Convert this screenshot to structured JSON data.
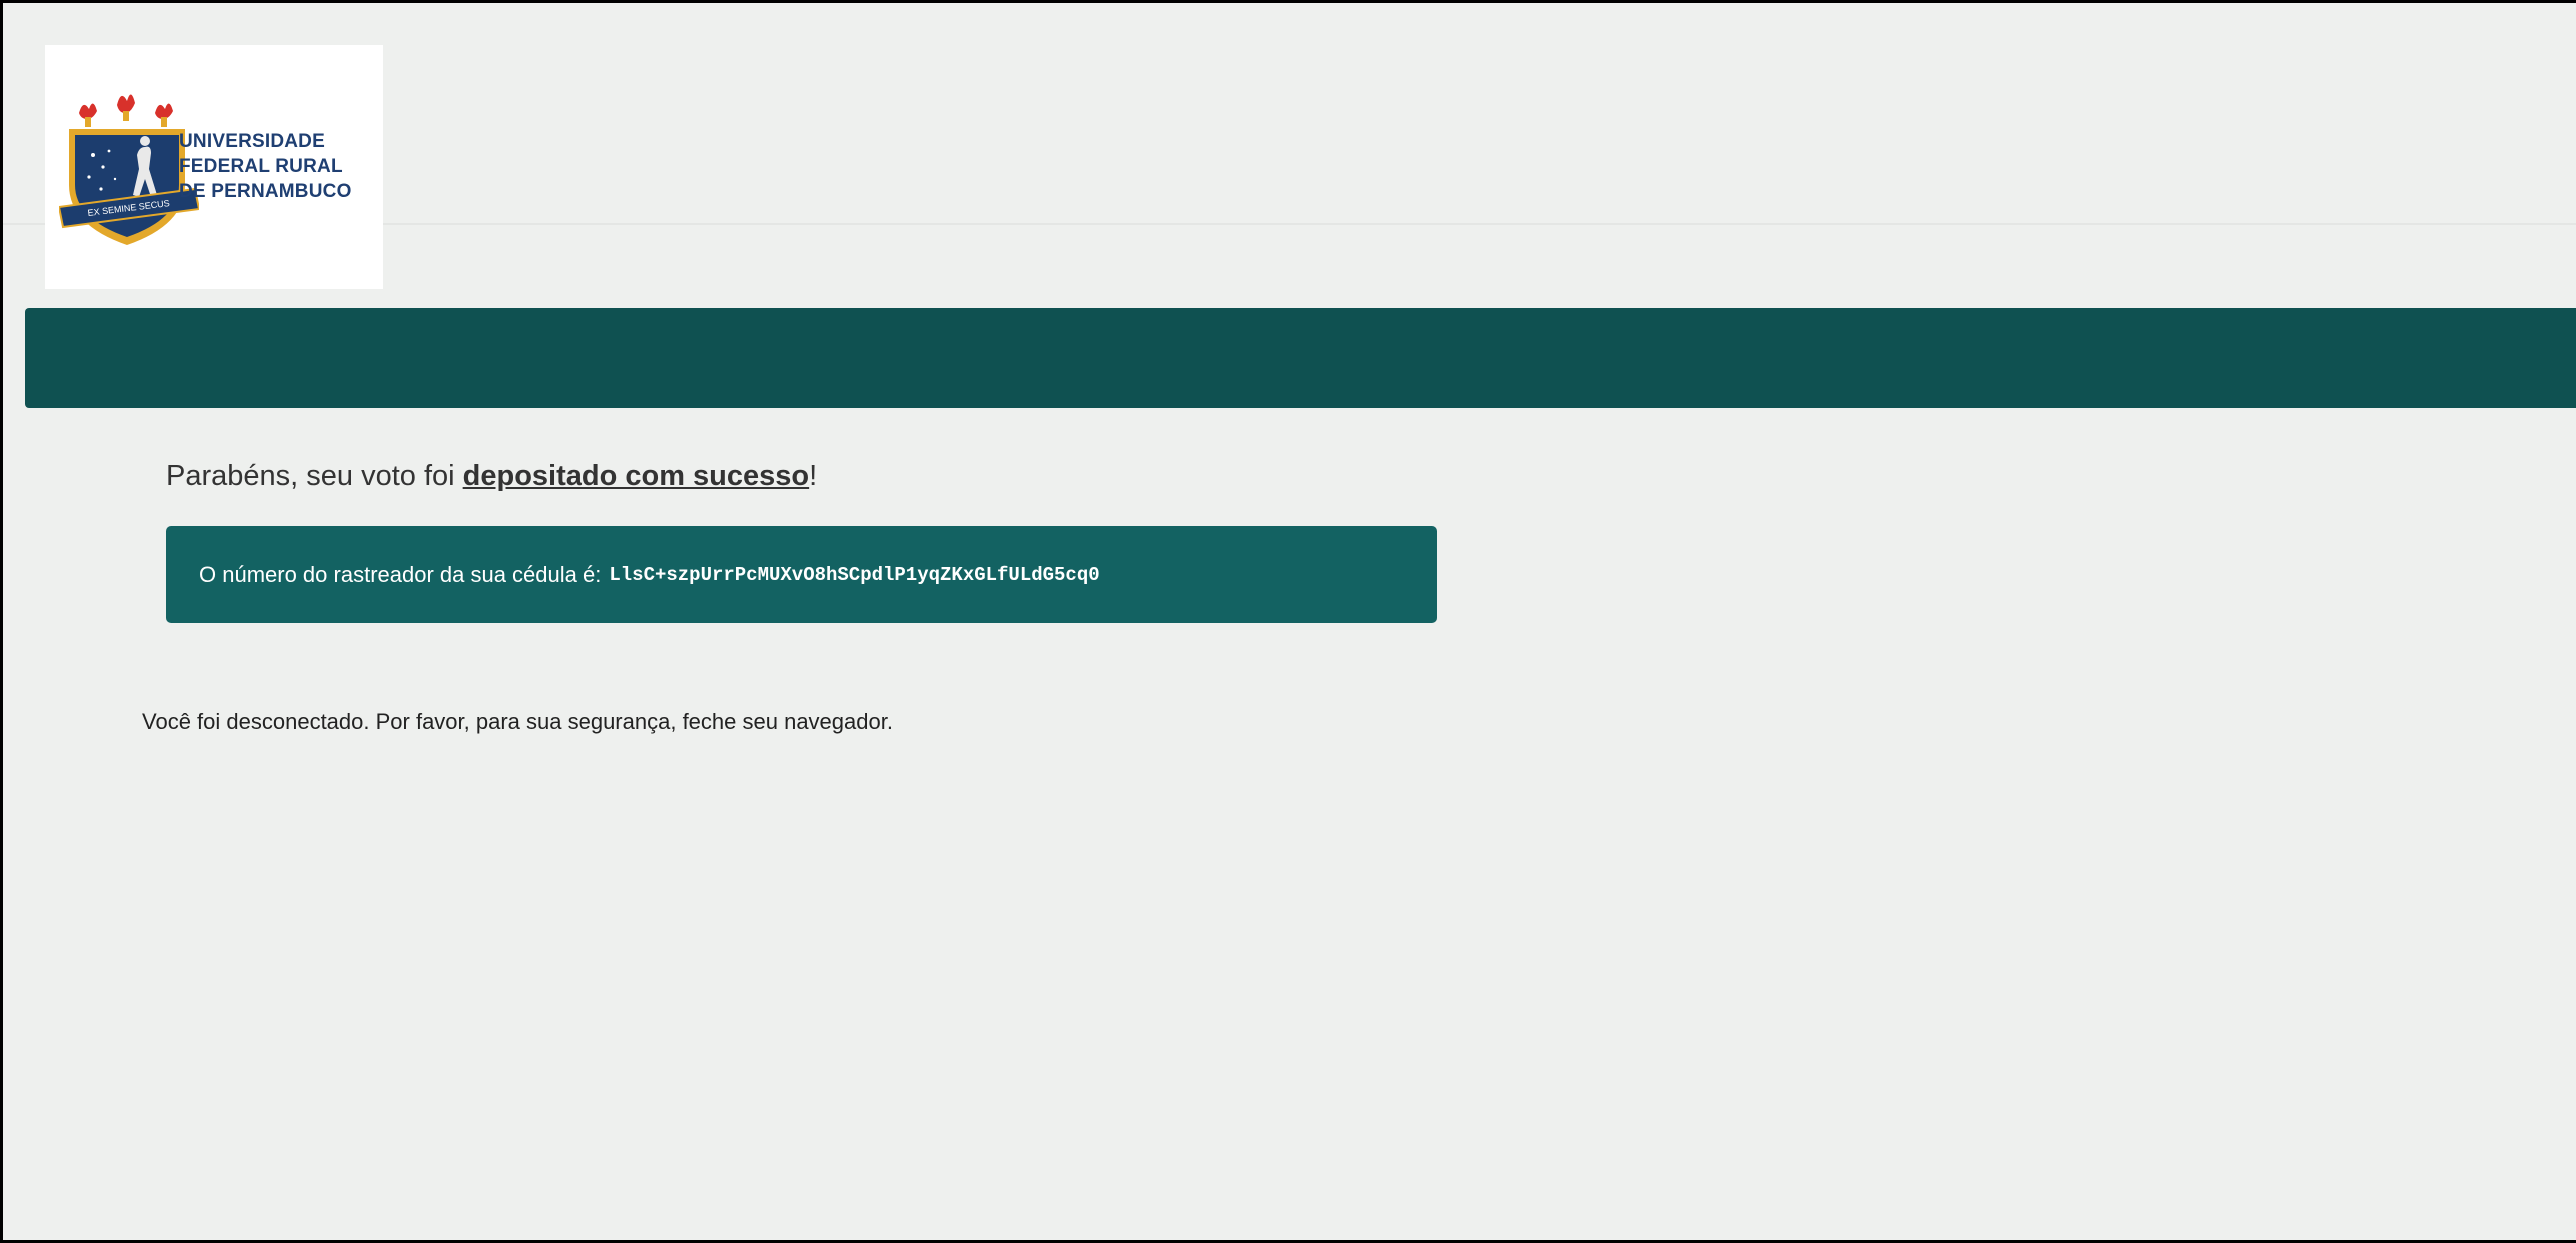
{
  "brand": {
    "logo_lines": [
      "UNIVERSIDADE",
      "FEDERAL RURAL",
      "DE PERNAMBUCO"
    ],
    "crest_motto": "EX SEMINE SECUS"
  },
  "colors": {
    "page_background": "#eef0ee",
    "header_bar": "#0f5151",
    "tracker_box": "#136262",
    "logo_text": "#1f3f72"
  },
  "confirmation": {
    "prefix": "Parabéns, seu voto foi ",
    "emphasis": "depositado com sucesso",
    "suffix": "!"
  },
  "tracker": {
    "label": "O número do rastreador da sua cédula é:",
    "code": "LlsC+szpUrrPcMUXvO8hSCpdlP1yqZKxGLfULdG5cq0"
  },
  "logout_message": "Você foi desconectado. Por favor, para sua segurança, feche seu navegador."
}
